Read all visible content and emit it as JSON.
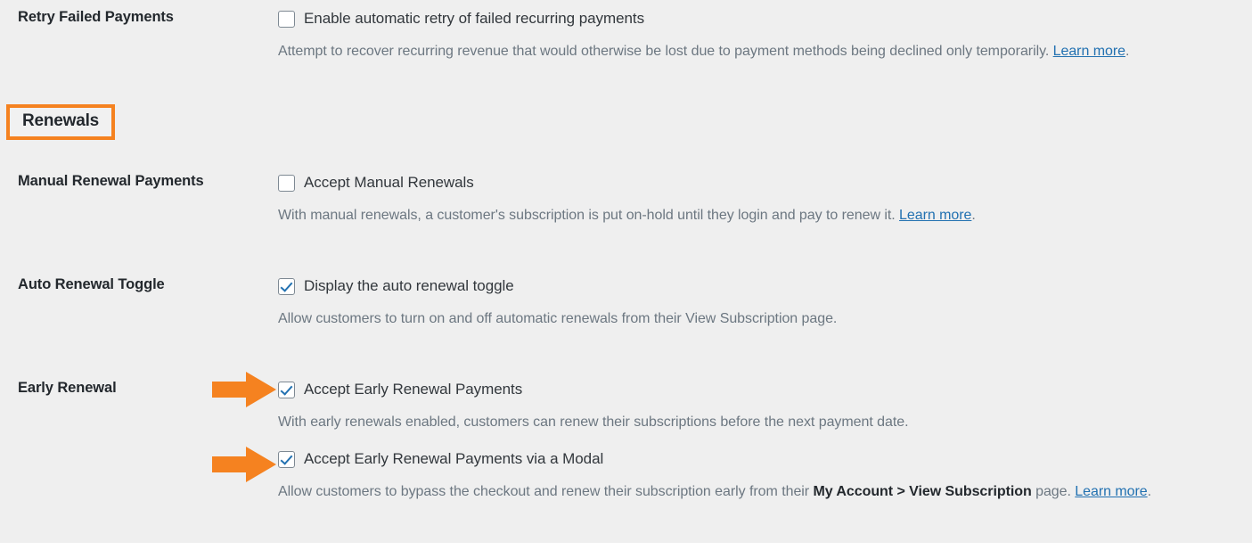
{
  "colors": {
    "background": "#efefef",
    "accent_orange": "#f58220",
    "link_blue": "#2271b1",
    "label_text": "#23282d",
    "description_text": "#6c7781"
  },
  "sections": [
    {
      "label": "Retry Failed Payments",
      "checkbox": {
        "name": "enable-automatic-retry",
        "label": "Enable automatic retry of failed recurring payments",
        "checked": false
      },
      "description": {
        "text": "Attempt to recover recurring revenue that would otherwise be lost due to payment methods being declined only temporarily.",
        "link": "Learn more",
        "suffix": "."
      }
    }
  ],
  "section_heading": {
    "label": "Renewals",
    "highlighted": true
  },
  "settings": [
    {
      "label": "Manual Renewal Payments",
      "checkbox": {
        "name": "accept-manual-renewals",
        "label": "Accept Manual Renewals",
        "checked": false
      },
      "description": {
        "text": "With manual renewals, a customer's subscription is put on-hold until they login and pay to renew it.",
        "link": "Learn more",
        "suffix": "."
      },
      "has_arrow": false
    },
    {
      "label": "Auto Renewal Toggle",
      "checkbox": {
        "name": "display-auto-renewal-toggle",
        "label": "Display the auto renewal toggle",
        "checked": true
      },
      "description": {
        "text": "Allow customers to turn on and off automatic renewals from their View Subscription page.",
        "link": "",
        "suffix": ""
      },
      "has_arrow": false
    },
    {
      "label": "Early Renewal",
      "checkbox": {
        "name": "accept-early-renewal-payments",
        "label": "Accept Early Renewal Payments",
        "checked": true
      },
      "description": {
        "text": "With early renewals enabled, customers can renew their subscriptions before the next payment date.",
        "link": "",
        "suffix": ""
      },
      "has_arrow": true
    },
    {
      "label": "",
      "checkbox": {
        "name": "accept-early-renewal-payments-via-modal",
        "label": "Accept Early Renewal Payments via a Modal",
        "checked": true
      },
      "description": {
        "prefix": "Allow customers to bypass the checkout and renew their subscription early from their ",
        "bold": "My Account > View Subscription",
        "middle": " page. ",
        "link": "Learn more",
        "suffix": "."
      },
      "has_arrow": true
    }
  ],
  "icons": {
    "arrow": "right-arrow-icon",
    "checkbox_checked": "checkmark-icon"
  }
}
